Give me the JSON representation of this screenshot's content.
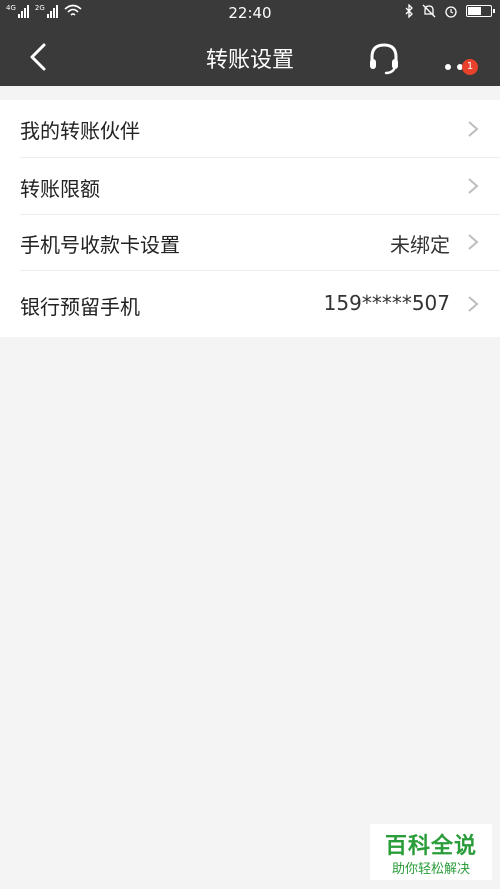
{
  "status_bar": {
    "time": "22:40",
    "sim1": "4G",
    "sim2": "2G",
    "icons": [
      "signal-icon",
      "signal-icon",
      "wifi-icon",
      "bluetooth-icon",
      "mute-icon",
      "alarm-icon",
      "battery-icon"
    ],
    "battery_level": 0.55
  },
  "nav": {
    "title": "转账设置",
    "badge_count": "1",
    "back_icon": "back-arrow-icon",
    "service_icon": "headset-icon",
    "more_icon": "more-dots-icon",
    "background": "#3a3a3a",
    "badge_color": "#e8412c"
  },
  "settings": {
    "items": [
      {
        "label": "我的转账伙伴",
        "value": ""
      },
      {
        "label": "转账限额",
        "value": ""
      },
      {
        "label": "手机号收款卡设置",
        "value": "未绑定"
      },
      {
        "label": "银行预留手机",
        "value": "159*****507"
      }
    ]
  },
  "watermark": {
    "title": "百科全说",
    "subtitle": "助你轻松解决",
    "color": "#2a9d3a"
  }
}
